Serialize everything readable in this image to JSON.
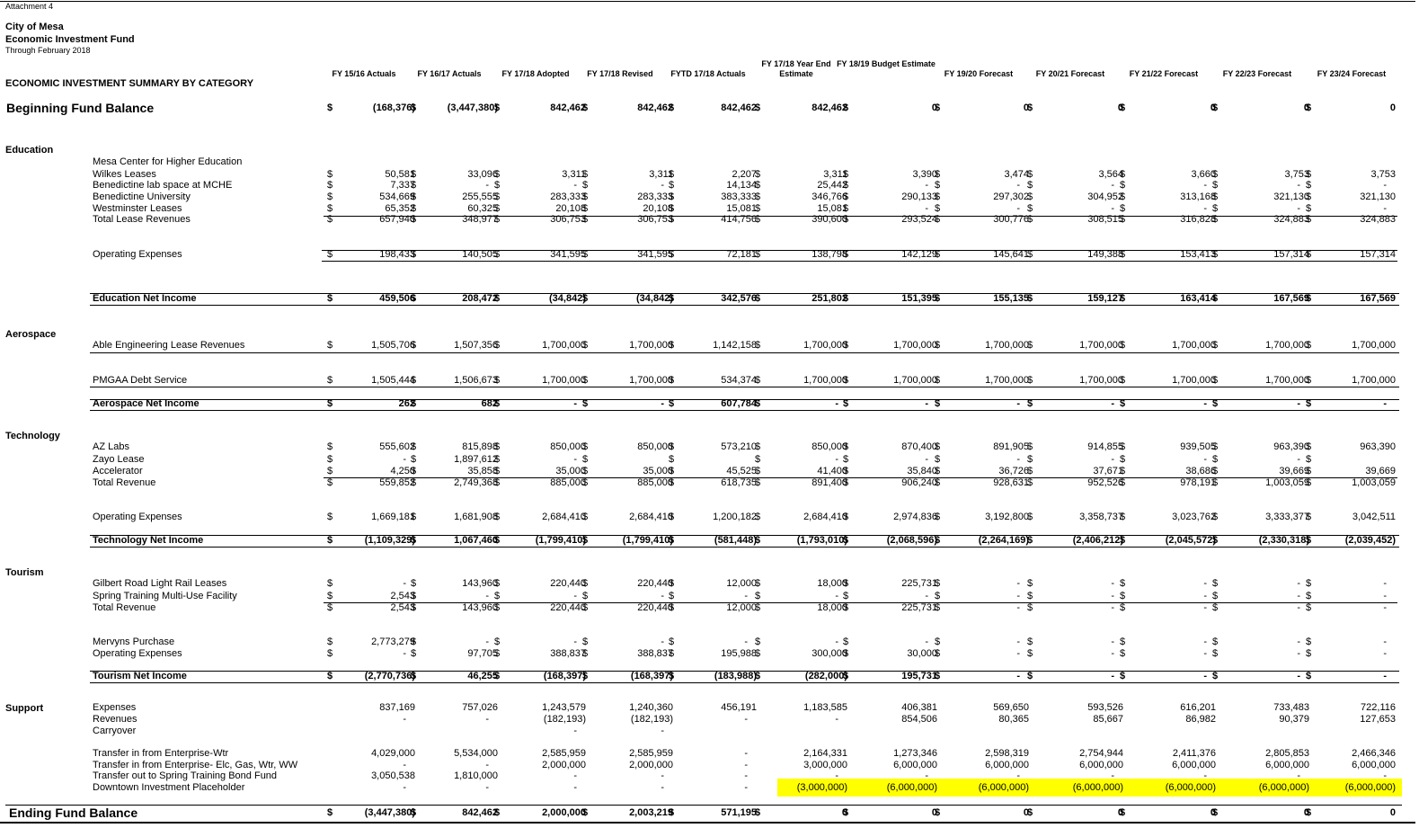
{
  "header": {
    "attachment": "Attachment 4",
    "org": "City of Mesa",
    "fund": "Economic Investment Fund",
    "through": "Through February 2018",
    "summary_title": "ECONOMIC INVESTMENT SUMMARY BY CATEGORY"
  },
  "columns": [
    "FY 15/16 Actuals",
    "FY 16/17 Actuals",
    "FY 17/18 Adopted",
    "FY 17/18 Revised",
    "FYTD 17/18 Actuals",
    "FY 17/18 Year End Estimate",
    "FY 18/19 Budget Estimate",
    "FY 19/20 Forecast",
    "FY 20/21 Forecast",
    "FY 21/22 Forecast",
    "FY 22/23 Forecast",
    "FY 23/24 Forecast"
  ],
  "categories": {
    "education": "Education",
    "aerospace": "Aerospace",
    "technology": "Technology",
    "tourism": "Tourism",
    "support": "Support"
  },
  "highlight_color": "#ffff00",
  "rows": [
    {
      "id": "beginning",
      "label": "Beginning Fund Balance",
      "style": "big",
      "dollars": true,
      "values": [
        "(168,376)",
        "(3,447,380)",
        "842,462",
        "842,462",
        "842,462",
        "842,462",
        "0",
        "0",
        "0",
        "0",
        "0",
        "0"
      ]
    },
    {
      "id": "mche",
      "label": "Mesa Center for Higher Education",
      "values": []
    },
    {
      "id": "wilkes",
      "label": "Wilkes Leases",
      "dollars": true,
      "values": [
        "50,581",
        "33,096",
        "3,311",
        "3,311",
        "2,207",
        "3,311",
        "3,390",
        "3,474",
        "3,564",
        "3,660",
        "3,753",
        "3,753"
      ]
    },
    {
      "id": "bene-lab",
      "label": "Benedictine lab space at MCHE",
      "dollars": true,
      "values": [
        "7,337",
        "-",
        "-",
        "-",
        "14,134",
        "25,442",
        "-",
        "-",
        "-",
        "-",
        "-",
        "-"
      ]
    },
    {
      "id": "bene-univ",
      "label": "Benedictine University",
      "dollars": true,
      "values": [
        "534,669",
        "255,555",
        "283,333",
        "283,333",
        "383,333",
        "346,766",
        "290,133",
        "297,302",
        "304,952",
        "313,168",
        "321,130",
        "321,130"
      ]
    },
    {
      "id": "westminster",
      "label": "Westminster Leases",
      "dollars": true,
      "values": [
        "65,352",
        "60,325",
        "20,108",
        "20,108",
        "15,081",
        "15,081",
        "-",
        "-",
        "-",
        "-",
        "-",
        "-"
      ]
    },
    {
      "id": "total-lease",
      "label": "Total Lease Revenues",
      "dollars": true,
      "values": [
        "657,940",
        "348,977",
        "306,753",
        "306,753",
        "414,756",
        "390,600",
        "293,524",
        "300,776",
        "308,515",
        "316,828",
        "324,883",
        "324,883"
      ]
    },
    {
      "id": "edu-opex",
      "label": "Operating Expenses",
      "dollars": true,
      "values": [
        "198,433",
        "140,505",
        "341,595",
        "341,595",
        "72,181",
        "138,798",
        "142,129",
        "145,641",
        "149,388",
        "153,413",
        "157,314",
        "157,314"
      ]
    },
    {
      "id": "edu-net",
      "label": "Education Net Income",
      "style": "bold",
      "dollars": true,
      "values": [
        "459,506",
        "208,472",
        "(34,842)",
        "(34,842)",
        "342,576",
        "251,802",
        "151,395",
        "155,135",
        "159,127",
        "163,414",
        "167,569",
        "167,569"
      ]
    },
    {
      "id": "able",
      "label": "Able Engineering Lease Revenues",
      "dollars": true,
      "values": [
        "1,505,706",
        "1,507,356",
        "1,700,000",
        "1,700,000",
        "1,142,158",
        "1,700,000",
        "1,700,000",
        "1,700,000",
        "1,700,000",
        "1,700,000",
        "1,700,000",
        "1,700,000"
      ]
    },
    {
      "id": "pmgaa",
      "label": "PMGAA Debt Service",
      "dollars": true,
      "values": [
        "1,505,444",
        "1,506,673",
        "1,700,000",
        "1,700,000",
        "534,374",
        "1,700,000",
        "1,700,000",
        "1,700,000",
        "1,700,000",
        "1,700,000",
        "1,700,000",
        "1,700,000"
      ]
    },
    {
      "id": "aero-net",
      "label": "Aerospace Net Income",
      "style": "bold",
      "dollars": true,
      "values": [
        "262",
        "682",
        "-",
        "-",
        "607,784",
        "-",
        "-",
        "-",
        "-",
        "-",
        "-",
        "-"
      ]
    },
    {
      "id": "azlabs",
      "label": "AZ Labs",
      "dollars": true,
      "values": [
        "555,602",
        "815,898",
        "850,000",
        "850,000",
        "573,210",
        "850,000",
        "870,400",
        "891,905",
        "914,855",
        "939,505",
        "963,390",
        "963,390"
      ]
    },
    {
      "id": "zayo",
      "label": "Zayo Lease",
      "dollars": true,
      "values": [
        "-",
        "1,897,612",
        "-",
        "",
        "",
        "-",
        "-",
        "-",
        "-",
        "-",
        "-",
        ""
      ]
    },
    {
      "id": "accel",
      "label": "Accelerator",
      "dollars": true,
      "values": [
        "4,250",
        "35,858",
        "35,000",
        "35,000",
        "45,525",
        "41,400",
        "35,840",
        "36,726",
        "37,671",
        "38,686",
        "39,669",
        "39,669"
      ]
    },
    {
      "id": "tech-total",
      "label": "Total Revenue",
      "dollars": true,
      "values": [
        "559,852",
        "2,749,368",
        "885,000",
        "885,000",
        "618,735",
        "891,400",
        "906,240",
        "928,631",
        "952,526",
        "978,191",
        "1,003,059",
        "1,003,059"
      ]
    },
    {
      "id": "tech-opex",
      "label": "Operating Expenses",
      "dollars": true,
      "values": [
        "1,669,181",
        "1,681,908",
        "2,684,410",
        "2,684,410",
        "1,200,182",
        "2,684,410",
        "2,974,836",
        "3,192,800",
        "3,358,737",
        "3,023,762",
        "3,333,377",
        "3,042,511"
      ]
    },
    {
      "id": "tech-net",
      "label": "Technology Net Income",
      "style": "bold",
      "dollars": true,
      "values": [
        "(1,109,329)",
        "1,067,460",
        "(1,799,410)",
        "(1,799,410)",
        "(581,448)",
        "(1,793,010)",
        "(2,068,596)",
        "(2,264,169)",
        "(2,406,212)",
        "(2,045,572)",
        "(2,330,318)",
        "(2,039,452)"
      ]
    },
    {
      "id": "gilbert",
      "label": "Gilbert Road Light Rail Leases",
      "dollars": true,
      "values": [
        "-",
        "143,960",
        "220,440",
        "220,440",
        "12,000",
        "18,000",
        "225,731",
        "-",
        "-",
        "-",
        "-",
        "-"
      ]
    },
    {
      "id": "spring",
      "label": "Spring Training Multi-Use Facility",
      "dollars": true,
      "values": [
        "2,543",
        "-",
        "-",
        "-",
        "-",
        "-",
        "-",
        "-",
        "-",
        "-",
        "-",
        "-"
      ]
    },
    {
      "id": "tour-total",
      "label": "Total Revenue",
      "dollars": true,
      "values": [
        "2,543",
        "143,960",
        "220,440",
        "220,440",
        "12,000",
        "18,000",
        "225,731",
        "-",
        "-",
        "-",
        "-",
        "-"
      ]
    },
    {
      "id": "mervyns",
      "label": "Mervyns Purchase",
      "dollars": true,
      "values": [
        "2,773,279",
        "-",
        "-",
        "-",
        "-",
        "-",
        "-",
        "-",
        "-",
        "-",
        "-",
        "-"
      ]
    },
    {
      "id": "tour-opex",
      "label": "Operating Expenses",
      "dollars": true,
      "values": [
        "-",
        "97,705",
        "388,837",
        "388,837",
        "195,988",
        "300,000",
        "30,000",
        "-",
        "-",
        "-",
        "-",
        "-"
      ]
    },
    {
      "id": "tour-net",
      "label": "Tourism Net Income",
      "style": "bold",
      "dollars": true,
      "values": [
        "(2,770,736)",
        "46,255",
        "(168,397)",
        "(168,397)",
        "(183,988)",
        "(282,000)",
        "195,731",
        "-",
        "-",
        "-",
        "-",
        "-"
      ]
    },
    {
      "id": "expenses",
      "label": "Expenses",
      "values": [
        "837,169",
        "757,026",
        "1,243,579",
        "1,240,360",
        "456,191",
        "1,183,585",
        "406,381",
        "569,650",
        "593,526",
        "616,201",
        "733,483",
        "722,116"
      ]
    },
    {
      "id": "revenues",
      "label": "Revenues",
      "values": [
        "-",
        "-",
        "(182,193)",
        "(182,193)",
        "-",
        "-",
        "854,506",
        "80,365",
        "85,667",
        "86,982",
        "90,379",
        "127,653"
      ]
    },
    {
      "id": "carryover",
      "label": "Carryover",
      "values": [
        "",
        "",
        "-",
        "-",
        "",
        "",
        "",
        "",
        "",
        "",
        "",
        ""
      ]
    },
    {
      "id": "xfer-wtr",
      "label": "Transfer in from Enterprise-Wtr",
      "values": [
        "4,029,000",
        "5,534,000",
        "2,585,959",
        "2,585,959",
        "-",
        "2,164,331",
        "1,273,346",
        "2,598,319",
        "2,754,944",
        "2,411,376",
        "2,805,853",
        "2,466,346"
      ]
    },
    {
      "id": "xfer-elc",
      "label": "Transfer in from Enterprise- Elc, Gas, Wtr, WW",
      "values": [
        "-",
        "-",
        "2,000,000",
        "2,000,000",
        "-",
        "3,000,000",
        "6,000,000",
        "6,000,000",
        "6,000,000",
        "6,000,000",
        "6,000,000",
        "6,000,000"
      ]
    },
    {
      "id": "xfer-spring",
      "label": "Transfer out to Spring Training Bond Fund",
      "values": [
        "3,050,538",
        "1,810,000",
        "-",
        "-",
        "-",
        "-",
        "-",
        "-",
        "-",
        "-",
        "-",
        "-"
      ]
    },
    {
      "id": "downtown",
      "label": "Downtown Investment Placeholder",
      "highlight": true,
      "values": [
        "-",
        "-",
        "-",
        "-",
        "-",
        "(3,000,000)",
        "(6,000,000)",
        "(6,000,000)",
        "(6,000,000)",
        "(6,000,000)",
        "(6,000,000)",
        "(6,000,000)"
      ]
    },
    {
      "id": "ending",
      "label": "Ending Fund Balance",
      "style": "big",
      "dollars": true,
      "values": [
        "(3,447,380)",
        "842,462",
        "2,000,000",
        "2,003,219",
        "571,195",
        "0",
        "0",
        "0",
        "0",
        "0",
        "0",
        "0"
      ]
    }
  ]
}
